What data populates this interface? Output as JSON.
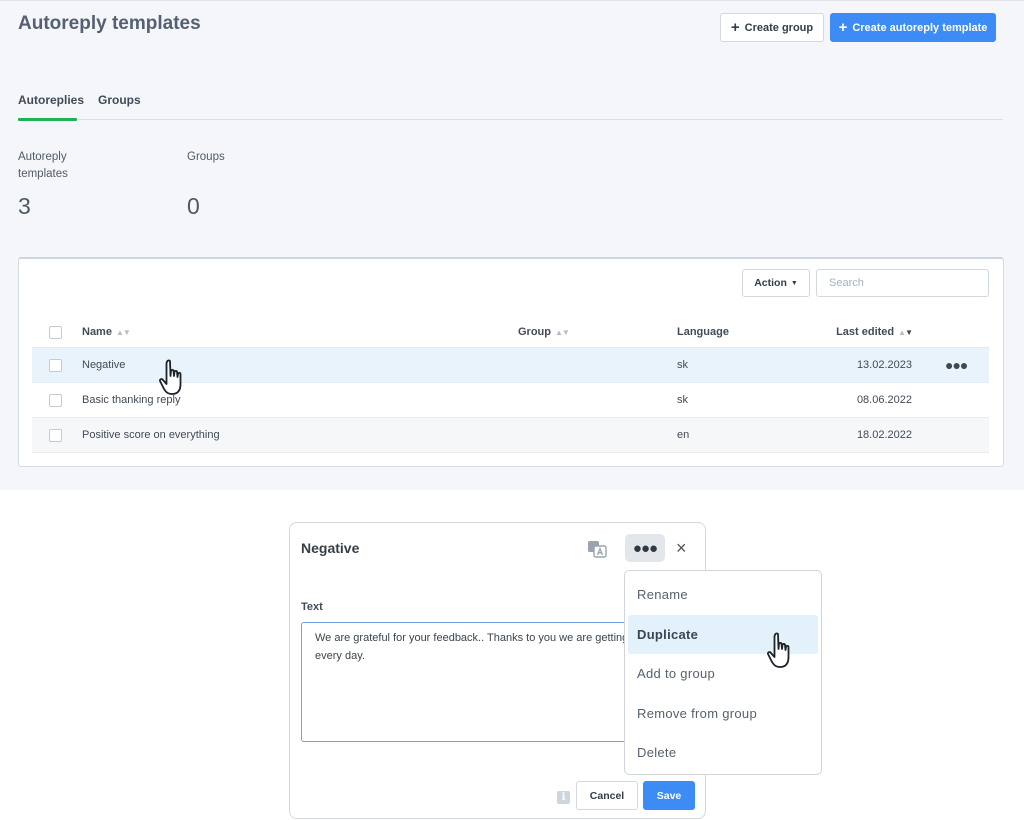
{
  "header": {
    "title": "Autoreply templates",
    "create_group_label": "Create group",
    "create_template_label": "Create autoreply template"
  },
  "tabs": [
    {
      "label": "Autoreplies",
      "active": true
    },
    {
      "label": "Groups",
      "active": false
    }
  ],
  "stats": [
    {
      "label": "Autoreply templates",
      "value": "3"
    },
    {
      "label": "Groups",
      "value": "0"
    }
  ],
  "table": {
    "action_label": "Action",
    "search_placeholder": "Search",
    "columns": {
      "name": "Name",
      "group": "Group",
      "language": "Language",
      "last_edited": "Last edited"
    },
    "rows": [
      {
        "name": "Negative",
        "group": "",
        "language": "sk",
        "last_edited": "13.02.2023",
        "hovered": true
      },
      {
        "name": "Basic thanking reply",
        "group": "",
        "language": "sk",
        "last_edited": "08.06.2022",
        "hovered": false
      },
      {
        "name": "Positive score on everything",
        "group": "",
        "language": "en",
        "last_edited": "18.02.2022",
        "hovered": false
      }
    ],
    "row_more_icon": "ellipsis-icon"
  },
  "modal": {
    "title": "Negative",
    "text_label": "Text",
    "text_value": "We are grateful for your feedback.. Thanks to you we are getting better every day.",
    "cancel_label": "Cancel",
    "save_label": "Save",
    "info_glyph": "i",
    "icons": [
      "translate-icon",
      "more-icon",
      "close-icon",
      "info-icon"
    ]
  },
  "menu": {
    "items": [
      {
        "label": "Rename",
        "active": false
      },
      {
        "label": "Duplicate",
        "active": true
      },
      {
        "label": "Add to group",
        "active": false
      },
      {
        "label": "Remove from group",
        "active": false
      },
      {
        "label": "Delete",
        "active": false
      }
    ]
  },
  "colors": {
    "primary": "#3d8cf5",
    "tab_active": "#1fb157",
    "row_hover": "#e8f3fb",
    "menu_active": "#e3f1fb",
    "panel_bg": "#f4f6f9"
  }
}
